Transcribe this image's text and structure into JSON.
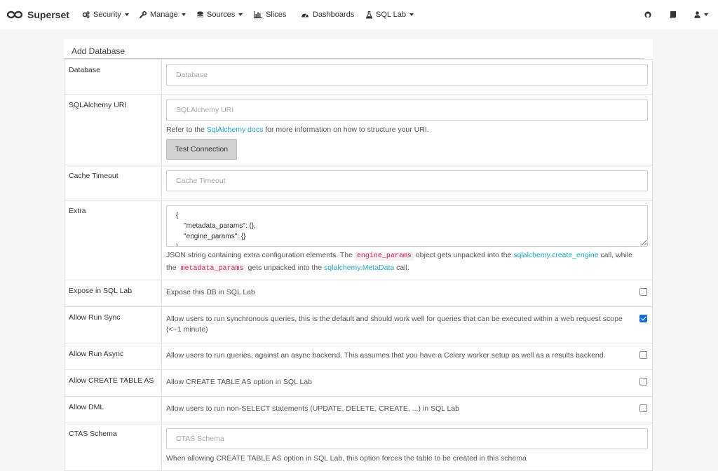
{
  "navbar": {
    "brand": "Superset",
    "items": [
      {
        "label": "Security",
        "icon": "gears-icon"
      },
      {
        "label": "Manage",
        "icon": "wrench-icon"
      },
      {
        "label": "Sources",
        "icon": "database-icon"
      },
      {
        "label": "Slices",
        "icon": "bar-chart-icon"
      },
      {
        "label": "Dashboards",
        "icon": "dashboard-icon"
      },
      {
        "label": "SQL Lab",
        "icon": "flask-icon"
      }
    ],
    "right_icons": [
      "github-icon",
      "book-icon",
      "user-icon"
    ]
  },
  "panel": {
    "title": "Add Database"
  },
  "form": {
    "database": {
      "label": "Database",
      "placeholder": "Database"
    },
    "sqlalchemy_uri": {
      "label": "SQLAlchemy URI",
      "placeholder": "SQLAlchemy URI",
      "help_before": "Refer to the ",
      "help_link": "SqlAlchemy docs",
      "help_after": " for more information on how to structure your URI.",
      "button": "Test Connection"
    },
    "cache_timeout": {
      "label": "Cache Timeout",
      "placeholder": "Cache Timeout"
    },
    "extra": {
      "label": "Extra",
      "value": "{\n    \"metadata_params\": {},\n    \"engine_params\": {}\n}",
      "help_1": "JSON string containing extra configuration elements. The ",
      "code_1": "engine_params",
      "help_2": " object gets unpacked into the ",
      "link_1": "sqlalchemy.create_engine",
      "help_3": " call, while the ",
      "code_2": "metadata_params",
      "help_4": " gets unpacked into the ",
      "link_2": "sqlalchemy.MetaData",
      "help_5": " call."
    },
    "expose_in_sqllab": {
      "label": "Expose in SQL Lab",
      "text": "Expose this DB in SQL Lab",
      "checked": false
    },
    "allow_run_sync": {
      "label": "Allow Run Sync",
      "text": "Allow users to run synchronous queries, this is the default and should work well for queries that can be executed within a web request scope (<~1 minute)",
      "checked": true
    },
    "allow_run_async": {
      "label": "Allow Run Async",
      "text": "Allow users to run queries, against an async backend. This assumes that you have a Celery worker setup as well as a results backend.",
      "checked": false
    },
    "allow_ctas": {
      "label": "Allow CREATE TABLE AS",
      "text": "Allow CREATE TABLE AS option in SQL Lab",
      "checked": false
    },
    "allow_dml": {
      "label": "Allow DML",
      "text": "Allow users to run non-SELECT statements (UPDATE, DELETE, CREATE, ...) in SQL Lab",
      "checked": false
    },
    "ctas_schema": {
      "label": "CTAS Schema",
      "placeholder": "CTAS Schema",
      "help": "When allowing CREATE TABLE AS option in SQL Lab, this option forces the table to be created in this schema"
    }
  },
  "colors": {
    "link": "#20a7c9",
    "checkbox_checked": "#1a6fd1"
  }
}
